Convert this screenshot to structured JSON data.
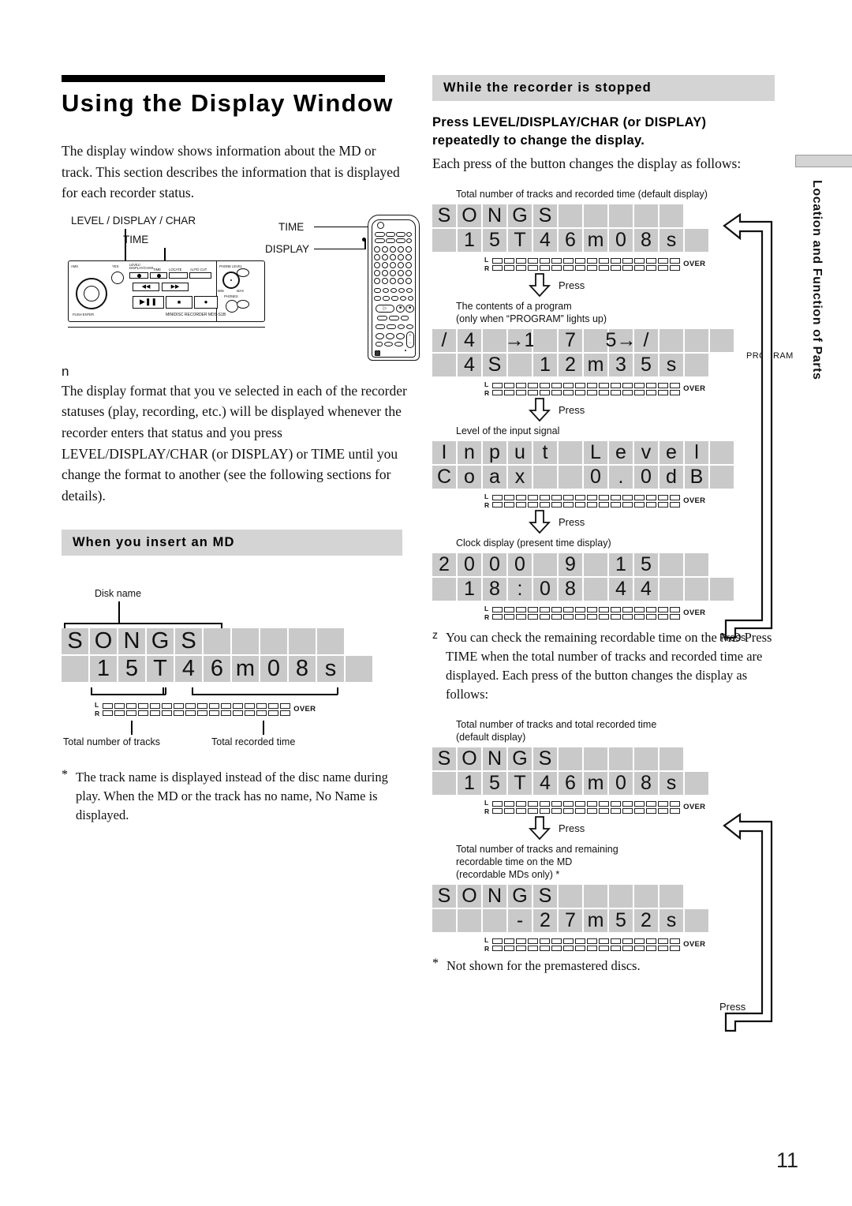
{
  "page": {
    "folio": "11"
  },
  "sidebar": {
    "tab_label": "Location and Function of Parts"
  },
  "left": {
    "title": "Using the Display Window",
    "intro": "The display window shows information about the MD or track.  This section describes the information that is displayed for each recorder status.",
    "diagram": {
      "label_level_display_char": "LEVEL / DISPLAY / CHAR",
      "label_time": "TIME",
      "remote_label_time": "TIME",
      "remote_label_display": "DISPLAY",
      "recorder_model": "MINIDISC RECORDER MDS-S1B",
      "panel_labels": {
        "ams": "AMS",
        "yes": "YES",
        "level_display_char": "LEVEL /\nDISPLAY/CHAR",
        "time": "TIME",
        "locate": "LOCATE",
        "auto_cut": "AUTO CUT",
        "phone_level": "PHONE LEVEL",
        "phones": "PHONES",
        "min": "MIN",
        "max": "MAX",
        "push_enter": "PUSH ENTER"
      }
    },
    "note_marker": "n",
    "note_body": "The display format that you ve selected in each of the recorder statuses (play, recording, etc.) will be displayed whenever the recorder enters that status and you press LEVEL/DISPLAY/CHAR (or DISPLAY) or TIME until you change the format to another (see the following sections for details).",
    "section_heading": "When you insert an MD",
    "insert_md": {
      "callout_disk_name": "Disk name",
      "callout_total_tracks": "Total number of tracks",
      "callout_total_time": "Total recorded time",
      "display": {
        "row1": [
          "S",
          "O",
          "N",
          "G",
          "S",
          "",
          "",
          "",
          "",
          ""
        ],
        "row2": [
          "",
          "1",
          "5",
          "T",
          "4",
          "6",
          "m",
          "0",
          "8",
          "s",
          ""
        ],
        "over_label": "OVER",
        "l_label": "L",
        "r_label": "R"
      }
    },
    "footnote": "The track name is displayed instead of the disc name during play.  When the MD or the track has no name,  No Name  is displayed.",
    "footnote_marker": "*"
  },
  "right": {
    "section_heading": "While the recorder is stopped",
    "instruction_bold_line1": "Press LEVEL/DISPLAY/CHAR (or DISPLAY)",
    "instruction_bold_line2": "repeatedly to change the display.",
    "instruction_body": "Each press of the button changes the display as follows:",
    "press_label": "Press",
    "over_label": "OVER",
    "l_label": "L",
    "r_label": "R",
    "steps": [
      {
        "caption": "Total number of tracks and recorded time (default display)",
        "row1": [
          "S",
          "O",
          "N",
          "G",
          "S",
          "",
          "",
          "",
          "",
          ""
        ],
        "row2": [
          "",
          "1",
          "5",
          "T",
          "4",
          "6",
          "m",
          "0",
          "8",
          "s",
          ""
        ],
        "side_label": ""
      },
      {
        "caption": "The contents of a program\n(only when “PROGRAM” lights up)",
        "row1": [
          "/",
          "4",
          "",
          "→1",
          "",
          "7",
          "",
          "5→",
          "/",
          "",
          "",
          ""
        ],
        "row2": [
          "",
          "4",
          "S",
          "",
          "1",
          "2",
          "m",
          "3",
          "5",
          "s",
          ""
        ],
        "side_label": "PROGRAM"
      },
      {
        "caption": "Level of the input signal",
        "row1": [
          "I",
          "n",
          "p",
          "u",
          "t",
          "",
          "L",
          "e",
          "v",
          "e",
          "l",
          ""
        ],
        "row2": [
          "C",
          "o",
          "a",
          "x",
          "",
          "",
          "0",
          ".",
          "0",
          "d",
          "B",
          ""
        ],
        "side_label": ""
      },
      {
        "caption": "Clock display (present time display)",
        "row1": [
          "2",
          "0",
          "0",
          "0",
          "",
          "9",
          "",
          "1",
          "5",
          "",
          ""
        ],
        "row2": [
          "",
          "1",
          "8",
          ":",
          "0",
          "8",
          "",
          "4",
          "4",
          "",
          "",
          ""
        ],
        "side_label": ""
      }
    ],
    "tip": {
      "marker": "z",
      "text": "You can check the remaining recordable time on the MD Press TIME when the total number of tracks and recorded time are displayed.  Each press of the button changes the display as follows:"
    },
    "steps2": [
      {
        "caption": "Total number of tracks and total recorded time\n(default display)",
        "row1": [
          "S",
          "O",
          "N",
          "G",
          "S",
          "",
          "",
          "",
          "",
          ""
        ],
        "row2": [
          "",
          "1",
          "5",
          "T",
          "4",
          "6",
          "m",
          "0",
          "8",
          "s",
          ""
        ]
      },
      {
        "caption": "Total number of tracks and remaining\nrecordable time on the MD\n(recordable MDs only) *",
        "row1": [
          "S",
          "O",
          "N",
          "G",
          "S",
          "",
          "",
          "",
          "",
          ""
        ],
        "row2": [
          "",
          "",
          "",
          "-",
          "2",
          "7",
          "m",
          "5",
          "2",
          "s",
          ""
        ]
      }
    ],
    "footnote": "Not shown for the premastered discs.",
    "footnote_marker": "*"
  },
  "colors": {
    "display_cell": "#c9c9c9",
    "heading_band": "#d4d4d4",
    "ink": "#111111"
  }
}
